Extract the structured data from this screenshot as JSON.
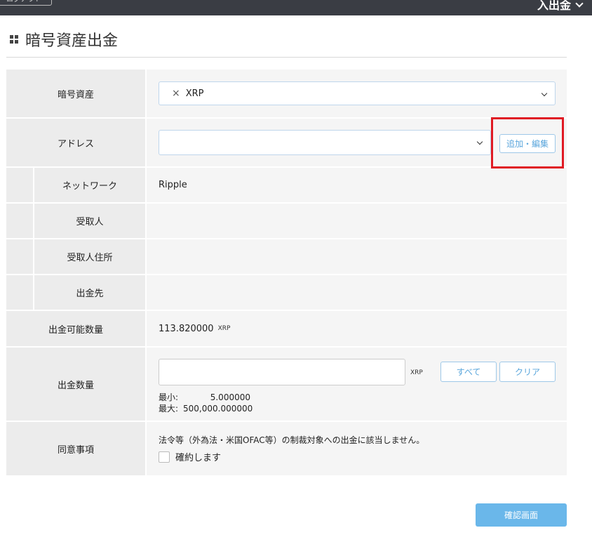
{
  "header": {
    "left_button": "ログアウト",
    "menu_label": "入出金"
  },
  "page": {
    "title": "暗号資産出金"
  },
  "form": {
    "asset": {
      "label": "暗号資産",
      "selected": "XRP",
      "clear_symbol": "×"
    },
    "address": {
      "label": "アドレス",
      "value": "",
      "edit_button": "追加・編集"
    },
    "network": {
      "label": "ネットワーク",
      "value": "Ripple"
    },
    "recipient": {
      "label": "受取人",
      "value": ""
    },
    "recipient_address": {
      "label": "受取人住所",
      "value": ""
    },
    "destination": {
      "label": "出金先",
      "value": ""
    },
    "available": {
      "label": "出金可能数量",
      "value": "113.820000",
      "unit": "XRP"
    },
    "amount": {
      "label": "出金数量",
      "value": "",
      "unit": "XRP",
      "all_button": "すべて",
      "clear_button": "クリア",
      "min_label": "最小:",
      "min_value": "5.000000",
      "max_label": "最大:",
      "max_value": "500,000.000000"
    },
    "consent": {
      "label": "同意事項",
      "text": "法令等（外為法・米国OFAC等）の制裁対象への出金に該当しません。",
      "checkbox_label": "確約します"
    }
  },
  "actions": {
    "confirm_button": "確認画面"
  },
  "colors": {
    "accent": "#6ab7ea",
    "highlight": "#e01b24",
    "topbar": "#3a3d44"
  }
}
